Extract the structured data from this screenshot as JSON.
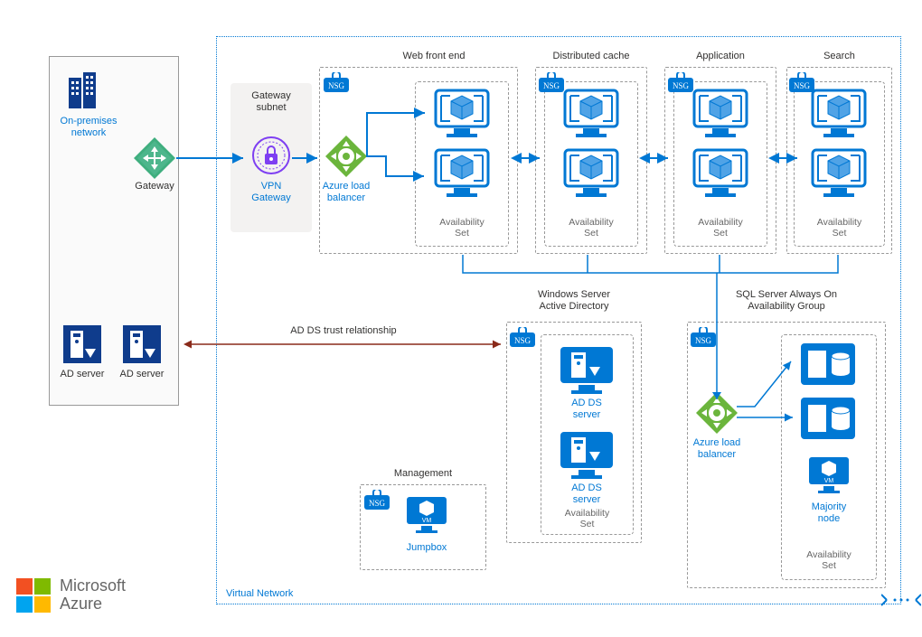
{
  "onprem": {
    "title": "On-premises\nnetwork",
    "gateway_label": "Gateway",
    "ad1_label": "AD server",
    "ad2_label": "AD server"
  },
  "vnet": {
    "label": "Virtual Network",
    "gateway_subnet_title": "Gateway\nsubnet",
    "vpn_gateway_label": "VPN\nGateway",
    "azure_lb_label": "Azure load\nbalancer",
    "azure_lb_label2": "Azure load\nbalancer",
    "nsg_label": "NSG",
    "availability_set_label": "Availability\nSet"
  },
  "tiers": {
    "web": "Web front end",
    "cache": "Distributed cache",
    "app": "Application",
    "search": "Search"
  },
  "midrow": {
    "ad_title": "Windows Server\nActive Directory",
    "sql_title": "SQL Server Always On\nAvailability Group",
    "trust_label": "AD DS trust relationship",
    "adds_label": "AD DS\nserver",
    "jumpbox_label": "Jumpbox",
    "management_label": "Management",
    "majority_label": "Majority\nnode"
  },
  "footer": {
    "brand1": "Microsoft",
    "brand2": "Azure"
  }
}
